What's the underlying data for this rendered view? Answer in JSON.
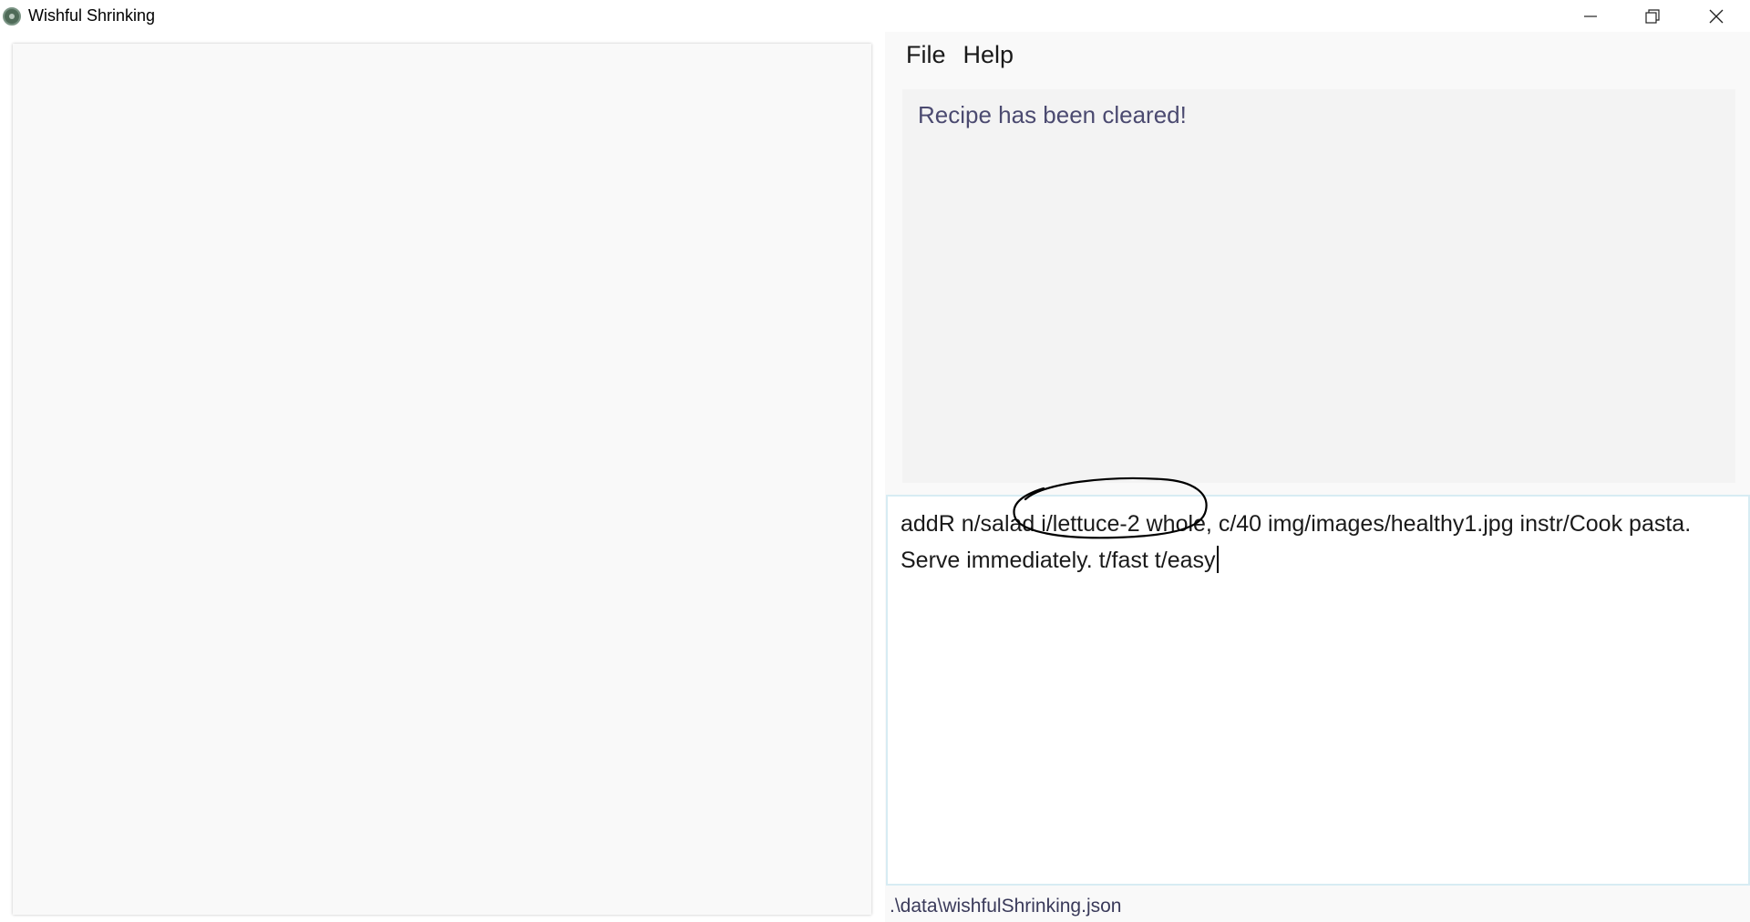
{
  "window": {
    "title": "Wishful Shrinking",
    "controls": {
      "minimize_icon": "minimize-icon",
      "maximize_icon": "restore-icon",
      "close_icon": "close-icon"
    }
  },
  "menu": {
    "items": [
      {
        "label": "File"
      },
      {
        "label": "Help"
      }
    ]
  },
  "result_display": {
    "message": "Recipe has been cleared!"
  },
  "command_box": {
    "value": "addR n/salad i/lettuce-2 whole, c/40 img/images/healthy1.jpg instr/Cook pasta. Serve immediately. t/fast t/easy"
  },
  "status_bar": {
    "file_path": ".\\data\\wishfulShrinking.json"
  },
  "colors": {
    "result_text": "#4b4a70",
    "panel_bg": "#f9f9f9",
    "command_border": "#d7ecf3",
    "app_icon": "#4f6b58"
  }
}
